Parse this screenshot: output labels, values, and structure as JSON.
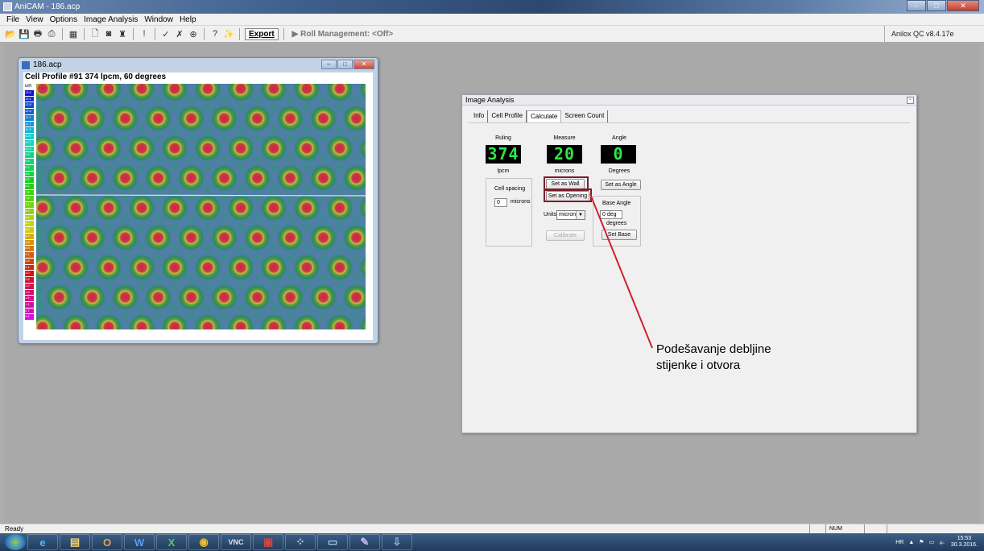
{
  "app": {
    "title": "AniCAM - 186.acp",
    "version": "Anilox QC v8.4.17e"
  },
  "menu": [
    "File",
    "View",
    "Options",
    "Image Analysis",
    "Window",
    "Help"
  ],
  "toolbar": {
    "export_label": "Export",
    "roll_label": "Roll Management: <Off>",
    "icons": [
      "open-icon",
      "save-icon",
      "print-icon",
      "print-preview-icon",
      "grid-icon",
      "new-icon",
      "camera-icon",
      "cup-icon",
      "exclamation-icon",
      "check-icon",
      "cross-icon",
      "target-icon",
      "question-icon",
      "wand-icon"
    ]
  },
  "image_window": {
    "title": "186.acp",
    "caption": "Cell Profile #91  374 lpcm, 60 degrees",
    "scale_unit": "um",
    "scale_values": [
      "13.5",
      "13.1",
      "12.8",
      "12.4",
      "12.1",
      "11.7",
      "11.3",
      "11.0",
      "10.7",
      "10.3",
      "9.9",
      "9.6",
      "9.2",
      "8.8",
      "8.5",
      "8.1",
      "7.8",
      "7.4",
      "7.1",
      "6.7",
      "6.4",
      "6.0",
      "5.6",
      "5.2",
      "4.9",
      "4.5",
      "4.1",
      "3.8",
      "3.4",
      "3.0",
      "2.6",
      "2.2",
      "1.9",
      "1.5",
      "1.1",
      "0.7",
      "0.4"
    ]
  },
  "analysis_window": {
    "title": "Image Analysis",
    "tabs": [
      "Info",
      "Cell Profile",
      "Calculate",
      "Screen Count"
    ],
    "active_tab": "Calculate",
    "ruling": {
      "label": "Ruling",
      "value": "374",
      "unit": "lpcm"
    },
    "measure": {
      "label": "Measure",
      "value": "20",
      "unit": "microns"
    },
    "angle": {
      "label": "Angle",
      "value": "0",
      "unit": "Degrees"
    },
    "set_wall_label": "Set as Wall",
    "set_opening_label": "Set as Opening",
    "set_angle_label": "Set as Angle",
    "cell_spacing": {
      "label": "Cell spacing",
      "value": "0",
      "unit": "microns"
    },
    "units": {
      "label": "Units",
      "value": "micron"
    },
    "calibrate_label": "Calibrate",
    "base_angle": {
      "label": "Base Angle",
      "value": "0 deg",
      "unit": "degrees",
      "button": "Set Base"
    }
  },
  "annotation": {
    "line1": "Podešavanje debljine",
    "line2": "stijenke i otvora",
    "color": "#d0202e"
  },
  "statusbar": {
    "text": "Ready",
    "num": "NUM"
  },
  "taskbar": {
    "items": [
      "ie-icon",
      "explorer-icon",
      "outlook-icon",
      "word-icon",
      "excel-icon",
      "chrome-icon",
      "vnc-icon",
      "anicam-icon",
      "grid-app-icon",
      "window-app-icon",
      "paint-icon",
      "pdf-icon"
    ],
    "lang": "HR",
    "time": "15:53",
    "date": "30.3.2016."
  }
}
